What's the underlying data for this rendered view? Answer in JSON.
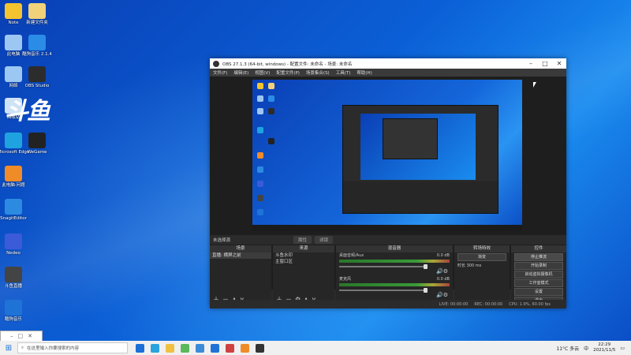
{
  "desktop": {
    "icons": [
      {
        "label": "Note",
        "color": "#f4c430"
      },
      {
        "label": "新建文件夹",
        "color": "#f1d27a"
      },
      {
        "label": "此电脑",
        "color": "#9cc7f2"
      },
      {
        "label": "酷狗音乐 2.1.4",
        "color": "#2a8ce6"
      },
      {
        "label": "网络",
        "color": "#9cc7f2"
      },
      {
        "label": "OBS Studio",
        "color": "#2c2c2c"
      },
      {
        "label": "回收站",
        "color": "#cfe3f7"
      },
      {
        "label": "",
        "color": "#ffffff"
      },
      {
        "label": "Microsoft Edge",
        "color": "#1fa3e0"
      },
      {
        "label": "WeGame",
        "color": "#222222"
      },
      {
        "label": "此电脑·问题",
        "color": "#f08c28"
      },
      {
        "label": "SnagitEditor",
        "color": "#2c8be0"
      },
      {
        "label": "Nedeo",
        "color": "#3b5bd9"
      },
      {
        "label": "斗鱼直播",
        "color": "#444444"
      },
      {
        "label": "酷狗音乐",
        "color": "#1f73d6"
      }
    ],
    "logo_text": "斗鱼"
  },
  "obs": {
    "title": "OBS 27.1.3 (64-bit, windows) - 配置文件: 未命名 - 场景: 未命名",
    "menu": [
      "文件(F)",
      "编辑(E)",
      "视图(V)",
      "配置文件(P)",
      "场景集合(S)",
      "工具(T)",
      "帮助(H)"
    ],
    "scene_label": "未选择源",
    "scene_buttons": [
      "属性",
      "滤镜"
    ],
    "docks": {
      "scenes": {
        "title": "场景",
        "items": [
          "直播: 横屏之前"
        ]
      },
      "sources": {
        "title": "来源",
        "items": [
          "斗鱼水印",
          "主窗口区"
        ]
      },
      "mixer": {
        "title": "混音器",
        "channels": [
          {
            "name": "桌面音频/Aux",
            "db": "0.0 dB"
          },
          {
            "name": "麦克风",
            "db": "0.0 dB"
          }
        ]
      },
      "transitions": {
        "title": "转场特效",
        "type": "渐变",
        "duration_label": "时长",
        "duration": "300 ms"
      },
      "controls": {
        "title": "控件",
        "buttons": [
          "停止推流",
          "开始录制",
          "启动虚拟摄像机",
          "工作室模式",
          "设置",
          "退出"
        ]
      }
    },
    "status": {
      "live": "LIVE: 00:00:00",
      "rec": "REC: 00:00:00",
      "cpu": "CPU: 1.9%, 60.00 fps"
    }
  },
  "taskbar": {
    "search_placeholder": "在这里输入你要搜索的内容",
    "weather": "11°C 多云",
    "lang": "中",
    "time": "22:29",
    "date": "2021/11/5",
    "apps": [
      "#1a6fd8",
      "#2aa3df",
      "#f0c040",
      "#5bb85b",
      "#3c8bd9",
      "#1f73d6",
      "#d04040",
      "#f08c28",
      "#333333"
    ]
  }
}
